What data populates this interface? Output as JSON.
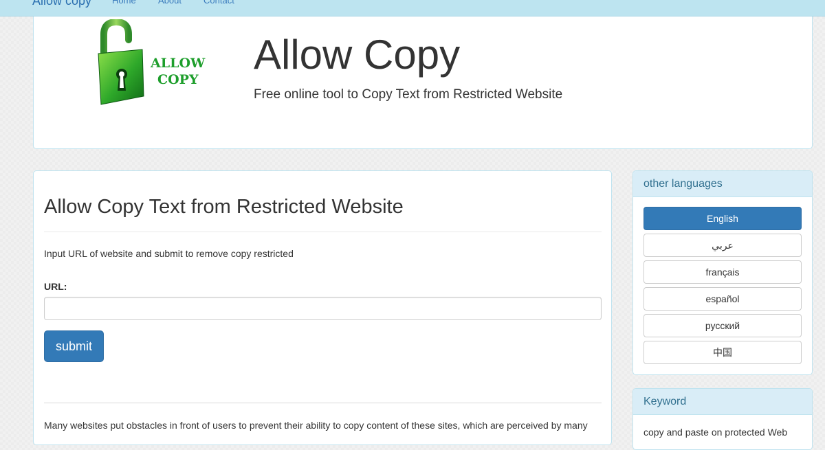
{
  "navbar": {
    "brand": "Allow copy",
    "links": [
      "Home",
      "About",
      "Contact"
    ]
  },
  "header": {
    "logo_text_line1": "ALLOW",
    "logo_text_line2": "COPY",
    "title": "Allow Copy",
    "subtitle": "Free online tool to Copy Text from Restricted Website"
  },
  "main": {
    "title": "Allow Copy Text from Restricted Website",
    "intro": "Input URL of website and submit to remove copy restricted",
    "url_label": "URL:",
    "url_value": "",
    "submit_label": "submit",
    "body_text": "Many websites put obstacles in front of users to prevent their ability to copy content of these sites, which are perceived by many"
  },
  "sidebar": {
    "languages_heading": "other languages",
    "languages": [
      "English",
      "عربي",
      "français",
      "español",
      "русский",
      "中国"
    ],
    "active_language": "English",
    "keyword_heading": "Keyword",
    "keyword_text": "copy and paste on protected Web"
  },
  "colors": {
    "navbar_bg": "#bde4f0",
    "primary": "#337ab7",
    "panel_heading_bg": "#d9edf7",
    "panel_heading_text": "#31708f",
    "logo_green": "#1d9e2b"
  }
}
